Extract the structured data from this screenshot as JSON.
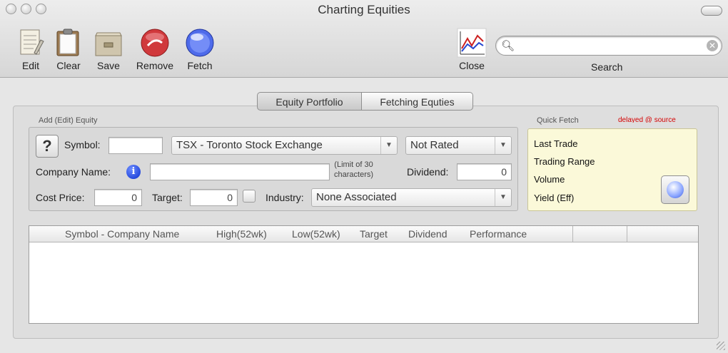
{
  "window": {
    "title": "Charting Equities"
  },
  "toolbar": {
    "edit": "Edit",
    "clear": "Clear",
    "save": "Save",
    "remove": "Remove",
    "fetch": "Fetch",
    "close": "Close",
    "search_label": "Search",
    "search_value": ""
  },
  "tabs": {
    "portfolio": "Equity Portfolio",
    "fetching": "Fetching Equties"
  },
  "add_equity": {
    "group_label": "Add (Edit) Equity",
    "help": "?",
    "symbol_label": "Symbol:",
    "symbol_value": "",
    "exchange": "TSX - Toronto Stock Exchange",
    "rating": "Not Rated",
    "company_label": "Company Name:",
    "company_value": "",
    "limit_note_1": "(Limit of 30",
    "limit_note_2": "characters)",
    "dividend_label": "Dividend:",
    "dividend_value": "0",
    "cost_label": "Cost Price:",
    "cost_value": "0",
    "target_label": "Target:",
    "target_value": "0",
    "industry_label": "Industry:",
    "industry_value": "None Associated"
  },
  "quick_fetch": {
    "group_label": "Quick Fetch",
    "delayed_note": "delayed @ source",
    "items": [
      "Last Trade",
      "Trading Range",
      "Volume",
      "Yield (Eff)"
    ]
  },
  "table": {
    "columns": [
      "Symbol - Company Name",
      "High(52wk)",
      "Low(52wk)",
      "Target",
      "Dividend",
      "Performance"
    ]
  }
}
